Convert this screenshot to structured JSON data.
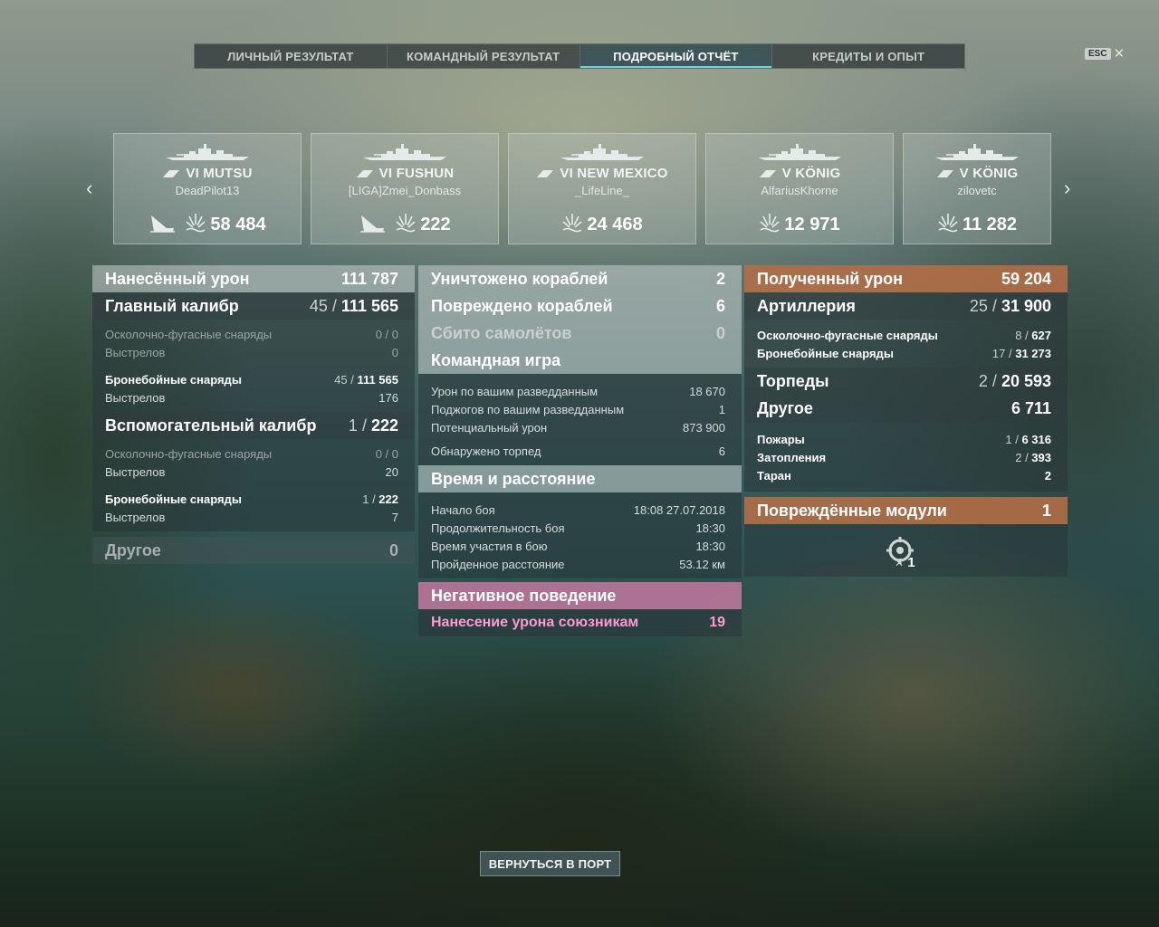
{
  "tabs": [
    "ЛИЧНЫЙ РЕЗУЛЬТАТ",
    "КОМАНДНЫЙ РЕЗУЛЬТАТ",
    "ПОДРОБНЫЙ ОТЧЁТ",
    "КРЕДИТЫ И ОПЫТ"
  ],
  "active_tab": "ПОДРОБНЫЙ ОТЧЁТ",
  "esc_label": "ESC",
  "ships": [
    {
      "name": "VI MUTSU",
      "player": "DeadPilot13",
      "damage": "58 484",
      "sunk_icon": true
    },
    {
      "name": "VI FUSHUN",
      "player": "[LIGA]Zmei_Donbass",
      "damage": "222",
      "sunk_icon": true
    },
    {
      "name": "VI NEW MEXICO",
      "player": "_LifeLine_",
      "damage": "24 468",
      "sunk_icon": false
    },
    {
      "name": "V KÖNIG",
      "player": "AlfariusKhorne",
      "damage": "12 971",
      "sunk_icon": false
    },
    {
      "name": "V KÖNIG",
      "player": "zilovetc",
      "damage": "11 282",
      "sunk_icon": false
    }
  ],
  "left": {
    "dealt": {
      "label": "Нанесённый урон",
      "value": "111 787"
    },
    "main": {
      "label": "Главный калибр",
      "hits": "45",
      "value": "111 565"
    },
    "main_he": {
      "label": "Осколочно-фугасные снаряды",
      "hits": "0",
      "value": "0"
    },
    "main_he_shots": {
      "label": "Выстрелов",
      "value": "0"
    },
    "main_ap": {
      "label": "Бронебойные снаряды",
      "hits": "45",
      "value": "111 565"
    },
    "main_ap_shots": {
      "label": "Выстрелов",
      "value": "176"
    },
    "secondary": {
      "label": "Вспомогательный калибр",
      "hits": "1",
      "value": "222"
    },
    "sec_he": {
      "label": "Осколочно-фугасные снаряды",
      "hits": "0",
      "value": "0"
    },
    "sec_he_shots": {
      "label": "Выстрелов",
      "value": "20"
    },
    "sec_ap": {
      "label": "Бронебойные снаряды",
      "hits": "1",
      "value": "222"
    },
    "sec_ap_shots": {
      "label": "Выстрелов",
      "value": "7"
    },
    "other": {
      "label": "Другое",
      "value": "0"
    }
  },
  "middle": {
    "destroyed": {
      "label": "Уничтожено кораблей",
      "value": "2"
    },
    "damaged": {
      "label": "Повреждено кораблей",
      "value": "6"
    },
    "planes": {
      "label": "Сбито самолётов",
      "value": "0"
    },
    "team": {
      "title": "Командная игра",
      "spotted_damage": {
        "label": "Урон по вашим разведданным",
        "value": "18 670"
      },
      "spotted_fires": {
        "label": "Поджогов по вашим разведданным",
        "value": "1"
      },
      "potential": {
        "label": "Потенциальный урон",
        "value": "873 900"
      },
      "torps_spotted": {
        "label": "Обнаружено торпед",
        "value": "6"
      }
    },
    "time": {
      "title": "Время и расстояние",
      "start": {
        "label": "Начало боя",
        "value": "18:08  27.07.2018"
      },
      "duration": {
        "label": "Продолжительность боя",
        "value": "18:30"
      },
      "participation": {
        "label": "Время участия в бою",
        "value": "18:30"
      },
      "distance": {
        "label": "Пройденное расстояние",
        "value": "53.12 км"
      }
    },
    "negative": {
      "title": "Негативное поведение",
      "team_damage": {
        "label": "Нанесение урона союзникам",
        "value": "19"
      }
    }
  },
  "right": {
    "received": {
      "label": "Полученный урон",
      "value": "59 204"
    },
    "artillery": {
      "label": "Артиллерия",
      "hits": "25",
      "value": "31 900"
    },
    "art_he": {
      "label": "Осколочно-фугасные снаряды",
      "hits": "8",
      "value": "627"
    },
    "art_ap": {
      "label": "Бронебойные снаряды",
      "hits": "17",
      "value": "31 273"
    },
    "torpedoes": {
      "label": "Торпеды",
      "hits": "2",
      "value": "20 593"
    },
    "other": {
      "label": "Другое",
      "value": "6 711"
    },
    "fires": {
      "label": "Пожары",
      "hits": "1",
      "value": "6 316"
    },
    "floods": {
      "label": "Затопления",
      "hits": "2",
      "value": "393"
    },
    "ram": {
      "label": "Таран",
      "value": "2"
    },
    "modules": {
      "label": "Повреждённые модули",
      "value": "1"
    },
    "module_count": "1"
  },
  "return_button": "ВЕРНУТЬСЯ В ПОРТ"
}
